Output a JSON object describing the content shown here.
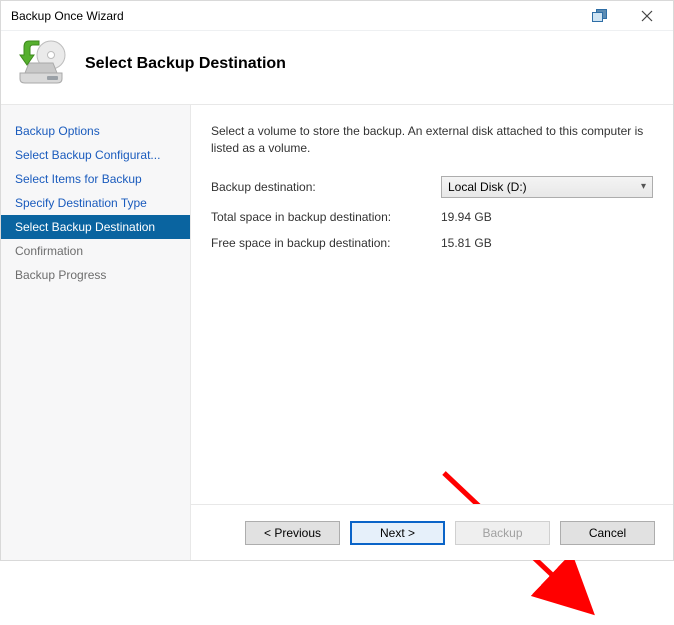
{
  "titlebar": {
    "title": "Backup Once Wizard"
  },
  "header": {
    "title": "Select Backup Destination"
  },
  "sidebar": {
    "items": [
      {
        "label": "Backup Options"
      },
      {
        "label": "Select Backup Configurat..."
      },
      {
        "label": "Select Items for Backup"
      },
      {
        "label": "Specify Destination Type"
      },
      {
        "label": "Select Backup Destination"
      },
      {
        "label": "Confirmation"
      },
      {
        "label": "Backup Progress"
      }
    ]
  },
  "main": {
    "intro": "Select a volume to store the backup. An external disk attached to this computer is listed as a volume.",
    "destination_label": "Backup destination:",
    "destination_value": "Local Disk (D:)",
    "total_label": "Total space in backup destination:",
    "total_value": "19.94 GB",
    "free_label": "Free space in backup destination:",
    "free_value": "15.81 GB"
  },
  "footer": {
    "previous": "< Previous",
    "next": "Next >",
    "backup": "Backup",
    "cancel": "Cancel"
  }
}
